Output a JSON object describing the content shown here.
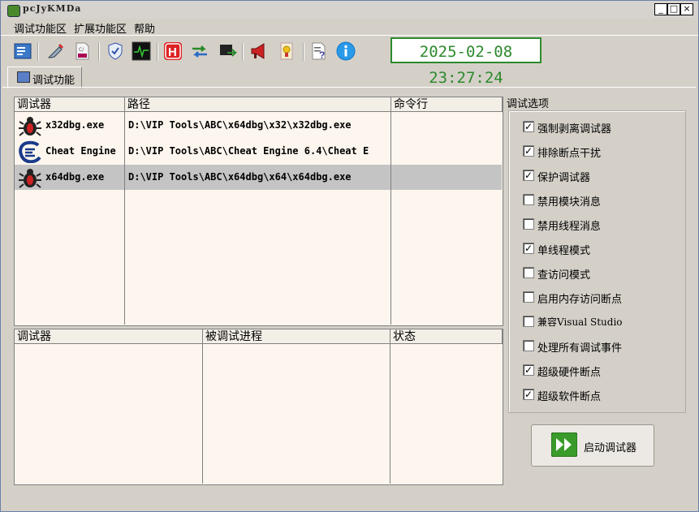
{
  "window": {
    "title": "pcJyKMDa",
    "controls": [
      "_",
      "□",
      "×"
    ]
  },
  "menu": [
    "调试功能区",
    "扩展功能区",
    "帮助"
  ],
  "toolbar": {
    "icons": [
      "config-icon",
      "syringe-icon",
      "cfg-file-icon",
      "shield-icon",
      "monitor-icon",
      "hook-icon",
      "exchange-icon",
      "plugin-icon",
      "speaker-icon",
      "bookmark-icon",
      "help-doc-icon",
      "info-icon"
    ]
  },
  "clock": "2025-02-08 23:27:24",
  "tab": {
    "label": "调试功能"
  },
  "debuggers": {
    "headers": [
      "调试器",
      "路径",
      "命令行"
    ],
    "rows": [
      {
        "name": "x32dbg.exe",
        "path": "D:\\VIP Tools\\ABC\\x64dbg\\x32\\x32dbg.exe",
        "cmd": "",
        "icon": "bug-icon",
        "selected": false
      },
      {
        "name": "Cheat Engine",
        "path": "D:\\VIP Tools\\ABC\\Cheat Engine 6.4\\Cheat E",
        "cmd": "",
        "icon": "cheat-engine-icon",
        "selected": false
      },
      {
        "name": "x64dbg.exe",
        "path": "D:\\VIP Tools\\ABC\\x64dbg\\x64\\x64dbg.exe",
        "cmd": "",
        "icon": "bug-icon",
        "selected": true
      }
    ]
  },
  "processes": {
    "headers": [
      "调试器",
      "被调试进程",
      "状态"
    ]
  },
  "options": {
    "label": "调试选项",
    "items": [
      {
        "label": "强制剥离调试器",
        "checked": true
      },
      {
        "label": "排除断点干扰",
        "checked": true
      },
      {
        "label": "保护调试器",
        "checked": true
      },
      {
        "label": "禁用模块消息",
        "checked": false
      },
      {
        "label": "禁用线程消息",
        "checked": false
      },
      {
        "label": "单线程模式",
        "checked": true
      },
      {
        "label": "查访问模式",
        "checked": false
      },
      {
        "label": "启用内存访问断点",
        "checked": false
      },
      {
        "label": "兼容Visual Studio",
        "checked": false
      },
      {
        "label": "处理所有调试事件",
        "checked": false
      },
      {
        "label": "超级硬件断点",
        "checked": true
      },
      {
        "label": "超级软件断点",
        "checked": true
      }
    ]
  },
  "start_button": {
    "label": "启动调试器"
  }
}
